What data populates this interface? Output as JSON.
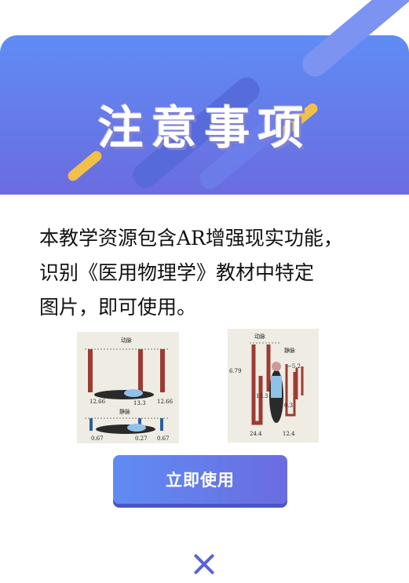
{
  "modal": {
    "title": "注意事项",
    "body_lines": [
      "本教学资源包含AR增强现实功能，",
      "识别《医用物理学》教材中特定",
      "图片，即可使用。"
    ],
    "button_label": "立即使用",
    "colors": {
      "header_start": "#5f8cf4",
      "header_end": "#6b6cdf",
      "accent_yellow": "#f0c04a",
      "close_icon": "#5c63d6"
    }
  },
  "figures": {
    "left": {
      "top_label": "动脉",
      "mid_label": "静脉",
      "top_values": [
        "12.66",
        "13.3",
        "12.66"
      ],
      "bottom_values": [
        "0.67",
        "0.27",
        "0.67"
      ]
    },
    "right": {
      "artery_label": "动脉",
      "vein_label": "静脉",
      "values": [
        "6.79",
        "−5.2",
        "13.3",
        "0.3",
        "24.4",
        "12.4"
      ]
    }
  }
}
